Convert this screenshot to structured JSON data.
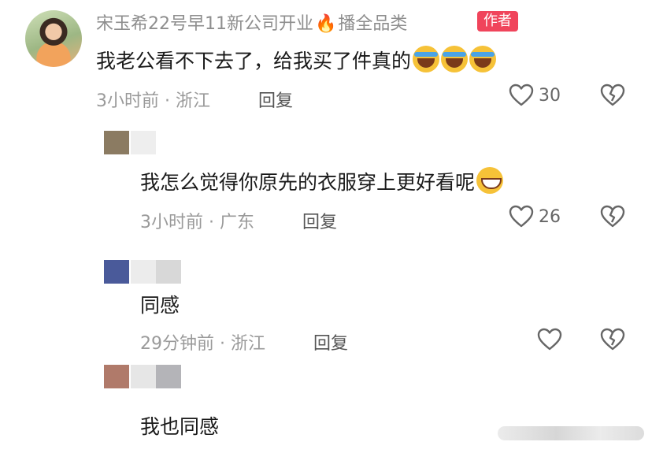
{
  "main_comment": {
    "username": "宋玉希22号早11新公司开业",
    "username_suffix": "播全品类",
    "author_badge": "作者",
    "content": "我老公看不下去了，给我买了件真的",
    "meta": "3小时前 · 浙江",
    "reply_label": "回复",
    "likes": "30"
  },
  "replies": [
    {
      "content": "我怎么觉得你原先的衣服穿上更好看呢",
      "meta": "3小时前 · 广东",
      "reply_label": "回复",
      "likes": "26"
    },
    {
      "content": "同感",
      "meta": "29分钟前 · 浙江",
      "reply_label": "回复",
      "likes": ""
    },
    {
      "content": "我也同感",
      "meta": "",
      "reply_label": "",
      "likes": ""
    }
  ],
  "colors": {
    "badge": "#f0445b",
    "meta_gray": "#9a9a9a",
    "icon_gray": "#666666",
    "redacted_1": "#8b7b62",
    "redacted_2": "#4a5a9a",
    "redacted_3": "#b07a6a"
  },
  "icons": [
    "heart-icon",
    "broken-heart-icon",
    "fire-icon",
    "laugh-cry-emoji",
    "grin-emoji"
  ]
}
